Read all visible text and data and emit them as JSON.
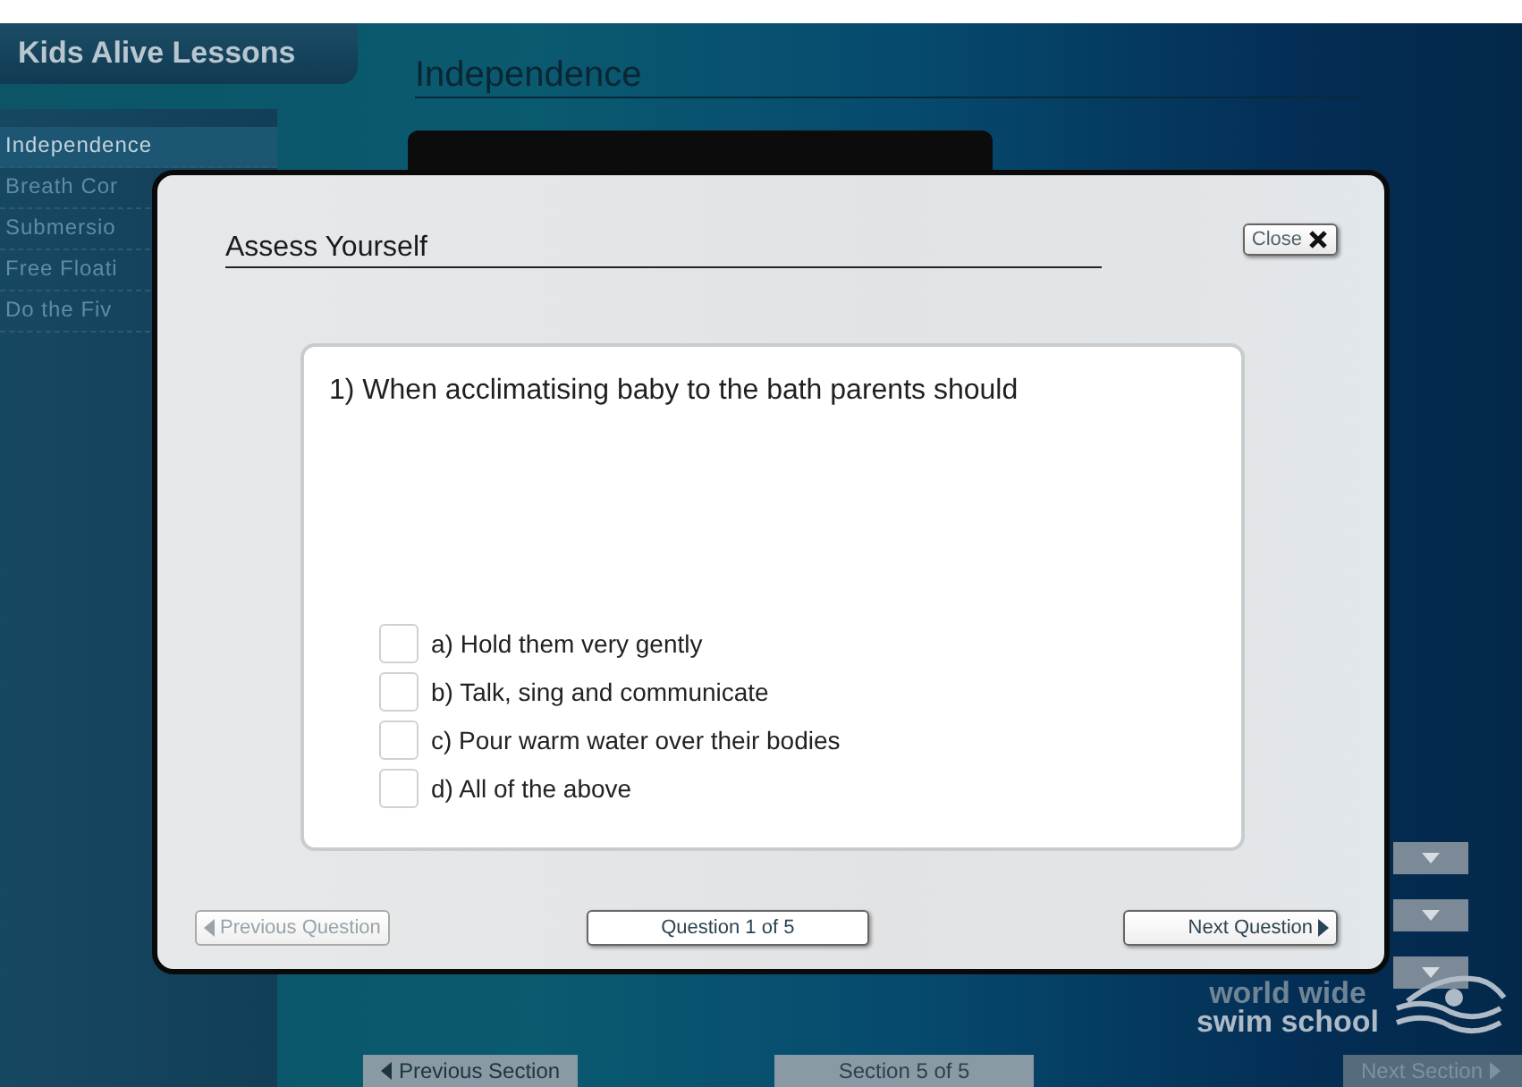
{
  "app": {
    "title": "Kids Alive Lessons"
  },
  "lesson_title": "Independence",
  "sidebar": {
    "items": [
      {
        "label": "Independence",
        "selected": true
      },
      {
        "label": "Breath Cor",
        "selected": false
      },
      {
        "label": "Submersio",
        "selected": false
      },
      {
        "label": "Free Floati",
        "selected": false
      },
      {
        "label": "Do the Fiv",
        "selected": false
      }
    ]
  },
  "logo": {
    "line1": "world wide",
    "line2": "swim school"
  },
  "footer": {
    "prev_section": {
      "label": "Previous Section",
      "disabled": false
    },
    "section_counter": "Section 5 of 5",
    "next_section": {
      "label": "Next Section",
      "disabled": true
    }
  },
  "modal": {
    "title": "Assess Yourself",
    "close_label": "Close",
    "question": "1) When acclimatising baby to the bath parents should",
    "options": [
      {
        "label": "a) Hold them very gently",
        "checked": false
      },
      {
        "label": "b) Talk, sing and communicate",
        "checked": false
      },
      {
        "label": "c) Pour warm water over their bodies",
        "checked": false
      },
      {
        "label": "d) All of the above",
        "checked": false
      }
    ],
    "prev_button": {
      "label": "Previous Question",
      "disabled": true
    },
    "counter": "Question 1 of 5",
    "next_button": {
      "label": "Next Question",
      "disabled": false
    }
  }
}
